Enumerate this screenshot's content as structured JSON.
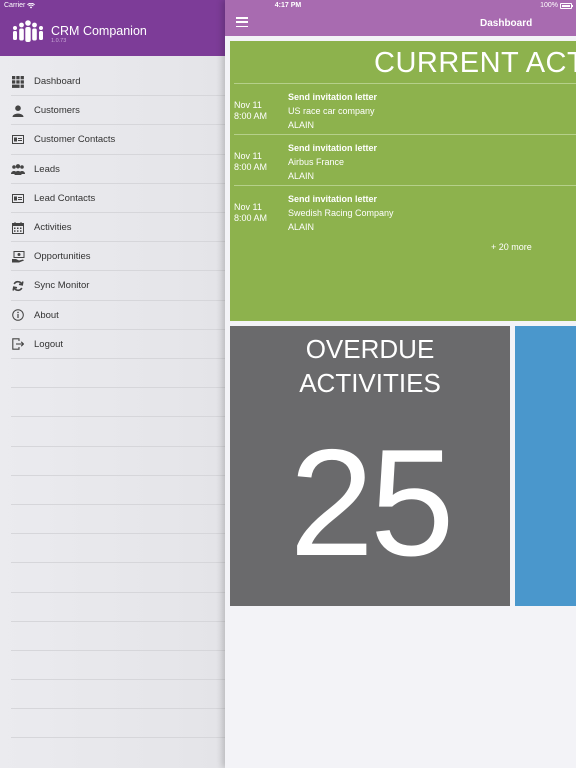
{
  "status_bar": {
    "carrier": "Carrier",
    "time": "4:17 PM",
    "battery": "100%"
  },
  "sidebar": {
    "app_title": "CRM Companion",
    "app_version": "1.0.73",
    "items": [
      {
        "label": "Dashboard",
        "icon": "dashboard-grid-icon"
      },
      {
        "label": "Customers",
        "icon": "person-icon"
      },
      {
        "label": "Customer Contacts",
        "icon": "id-card-icon"
      },
      {
        "label": "Leads",
        "icon": "group-icon"
      },
      {
        "label": "Lead Contacts",
        "icon": "id-card-icon"
      },
      {
        "label": "Activities",
        "icon": "calendar-icon"
      },
      {
        "label": "Opportunities",
        "icon": "money-hand-icon"
      },
      {
        "label": "Sync Monitor",
        "icon": "sync-icon"
      },
      {
        "label": "About",
        "icon": "info-icon"
      },
      {
        "label": "Logout",
        "icon": "logout-icon"
      }
    ]
  },
  "topbar": {
    "title": "Dashboard"
  },
  "current_activities": {
    "title": "CURRENT ACTIVITIES",
    "items": [
      {
        "date": "Nov 11",
        "time": "8:00 AM",
        "title": "Send invitation letter",
        "company": "US race car company",
        "owner": "ALAIN"
      },
      {
        "date": "Nov 11",
        "time": "8:00 AM",
        "title": "Send invitation letter",
        "company": "Airbus France",
        "owner": "ALAIN"
      },
      {
        "date": "Nov 11",
        "time": "8:00 AM",
        "title": "Send invitation letter",
        "company": "Swedish Racing Company",
        "owner": "ALAIN"
      }
    ],
    "more": "+ 20 more"
  },
  "overdue": {
    "line1": "OVERDUE",
    "line2": "ACTIVITIES",
    "count": "25"
  },
  "colors": {
    "sidebar_header": "#7d3c98",
    "topbar": "#a86bb0",
    "current_tile": "#8db24d",
    "overdue_tile": "#6a6a6c",
    "blue_tile": "#4a97cc"
  }
}
